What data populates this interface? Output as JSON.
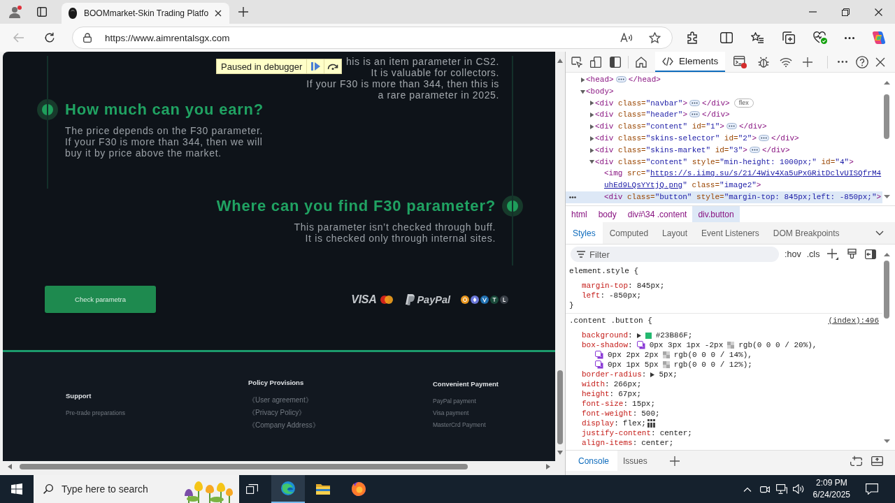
{
  "browser": {
    "tab": {
      "title": "BOOMmarket-Skin Trading Platfo",
      "selected": true
    },
    "back": {
      "disabled": true
    },
    "address": {
      "url": "https://www.aimrentalsgx.com"
    }
  },
  "page": {
    "debugger": {
      "label": "Paused in debugger"
    },
    "intro": {
      "lines": [
        "his is an item parameter in CS2.",
        "It is valuable for collectors.",
        "If your F30 is more than 344, then this is",
        "a rare parameter in 2025."
      ]
    },
    "sections": [
      {
        "kind": "left",
        "title": "How much can you earn?",
        "lines": [
          "The price depends on the F30 parameter.",
          "If your F30 is more than 344, then we will",
          "buy it by price above the market."
        ]
      },
      {
        "kind": "right",
        "title": "Where can you find F30 parameter?",
        "lines": [
          "This parameter isn’t checked through buff.",
          "It is checked only through internal sites."
        ]
      }
    ],
    "check_button": {
      "label": "Check parametra"
    },
    "payments": {
      "visa": "VISA",
      "paypal": "PayPal"
    },
    "footer": {
      "columns": [
        {
          "title": "Support",
          "links": [
            "Pre-trade preparations"
          ]
        },
        {
          "title": "Policy Provisions",
          "links": [
            "《User agreement》",
            "《Privacy Policy》",
            "《Company Address》"
          ]
        },
        {
          "title": "Convenient Payment",
          "links": [
            "PayPal payment",
            "Visa payment",
            "MasterCrd Payment"
          ]
        }
      ]
    }
  },
  "devtools": {
    "tabs": [
      {
        "label": "Elements",
        "selected": true
      }
    ],
    "dom_tree": [
      {
        "open": "<head",
        "end": ">",
        "close": "</head>",
        "expanded": false,
        "selected": false
      },
      {
        "open": "<body",
        "end": ">",
        "expanded": true,
        "selected": false,
        "children": [
          {
            "open": "<div",
            "attrs": [
              {
                "kind": "text",
                "name": "class=",
                "value": "\"navbar\""
              }
            ],
            "end": ">",
            "close": "</div>",
            "badge": "flex",
            "expanded": false,
            "selected": false
          },
          {
            "open": "<div",
            "attrs": [
              {
                "kind": "text",
                "name": "class=",
                "value": "\"header\""
              }
            ],
            "end": ">",
            "close": "</div>",
            "expanded": false,
            "selected": false
          },
          {
            "open": "<div",
            "attrs": [
              {
                "kind": "text",
                "name": "class=",
                "value": "\"content\""
              },
              {
                "kind": "text",
                "name": "id=",
                "value": "\"1\""
              }
            ],
            "end": ">",
            "close": "</div>",
            "expanded": false,
            "selected": false
          },
          {
            "open": "<div",
            "attrs": [
              {
                "kind": "text",
                "name": "class=",
                "value": "\"skins-selector\""
              },
              {
                "kind": "text",
                "name": "id=",
                "value": "\"2\""
              }
            ],
            "end": ">",
            "close": "</div>",
            "expanded": false,
            "selected": false
          },
          {
            "open": "<div",
            "attrs": [
              {
                "kind": "text",
                "name": "class=",
                "value": "\"skins-market\""
              },
              {
                "kind": "text",
                "name": "id=",
                "value": "\"3\""
              }
            ],
            "end": ">",
            "close": "</div>",
            "expanded": false,
            "selected": false
          },
          {
            "open": "<div",
            "attrs": [
              {
                "kind": "text",
                "name": "class=",
                "value": "\"content\""
              },
              {
                "kind": "text",
                "name": "style=",
                "value": "\"min-height: 1000px;\""
              },
              {
                "kind": "text",
                "name": "id=",
                "value": "\"4\""
              }
            ],
            "end": ">",
            "expanded": true,
            "selected": false,
            "children": [
              {
                "open": "<img",
                "attrs": [
                  {
                    "kind": "url",
                    "name": "src=",
                    "value": "\"https://s.iimg.su/s/21/4Wiv4Xa5uPxGRitDclvUISQfrM4uhEd9LQsYYtjQ.png\""
                  },
                  {
                    "kind": "text",
                    "name": "class=",
                    "value": "\"image2\""
                  }
                ],
                "end": ">",
                "selected": false
              },
              {
                "open": "<div",
                "attrs": [
                  {
                    "kind": "text",
                    "name": "class=",
                    "value": "\"button\""
                  },
                  {
                    "kind": "text",
                    "name": "style=",
                    "value": "\"margin-top: 845px;left: -850px;\""
                  }
                ],
                "end": ">",
                "selected": true
              }
            ]
          }
        ]
      }
    ],
    "breadcrumbs": [
      {
        "label": "html",
        "selected": false
      },
      {
        "label": "body",
        "selected": false
      },
      {
        "label": "div#\\34 .content",
        "selected": false
      },
      {
        "label": "div.button",
        "selected": true
      }
    ],
    "style_tabs": [
      {
        "label": "Styles",
        "selected": true
      },
      {
        "label": "Computed",
        "selected": false
      },
      {
        "label": "Layout",
        "selected": false
      },
      {
        "label": "Event Listeners",
        "selected": false
      },
      {
        "label": "DOM Breakpoints",
        "selected": false
      }
    ],
    "filter": {
      "placeholder": "Filter"
    },
    "filter_buttons": [
      ":hov",
      ".cls"
    ],
    "rules": [
      {
        "selector": "element.style {",
        "declarations": [
          {
            "kind": "plain",
            "name": "margin-top:",
            "value": "845px;"
          },
          {
            "kind": "plain",
            "name": "left:",
            "value": "-850px;"
          }
        ],
        "close": "}"
      },
      {
        "selector": ".content .button {",
        "source": "(index):496",
        "declarations": [
          {
            "kind": "color",
            "name": "background:",
            "color": "#23b86f",
            "value": "#23B86F;"
          },
          {
            "kind": "shadow",
            "name": "box-shadow:",
            "shadows": [
              {
                "offsets": "0px 3px 1px -2px",
                "value": "rgb(0 0 0 / 20%),"
              },
              {
                "offsets": "0px 2px 2px",
                "value": "rgb(0 0 0 / 14%),"
              },
              {
                "offsets": "0px 1px 5px",
                "value": "rgb(0 0 0 / 12%);"
              }
            ]
          },
          {
            "kind": "shorthand",
            "name": "border-radius:",
            "value": "5px;"
          },
          {
            "kind": "plain",
            "name": "width:",
            "value": "266px;"
          },
          {
            "kind": "plain",
            "name": "height:",
            "value": "67px;"
          },
          {
            "kind": "plain",
            "name": "font-size:",
            "value": "15px;"
          },
          {
            "kind": "plain",
            "name": "font-weight:",
            "value": "500;"
          },
          {
            "kind": "flex",
            "name": "display:",
            "value": "flex;"
          },
          {
            "kind": "plain",
            "name": "justify-content:",
            "value": "center;"
          },
          {
            "kind": "plain",
            "name": "align-items:",
            "value": "center;"
          }
        ]
      }
    ],
    "drawer_tabs": [
      {
        "label": "Console",
        "selected": true
      },
      {
        "label": "Issues",
        "selected": false
      }
    ]
  },
  "taskbar": {
    "search": {
      "placeholder": "Type here to search"
    },
    "time": "2:09 PM",
    "date": "6/24/2025"
  }
}
